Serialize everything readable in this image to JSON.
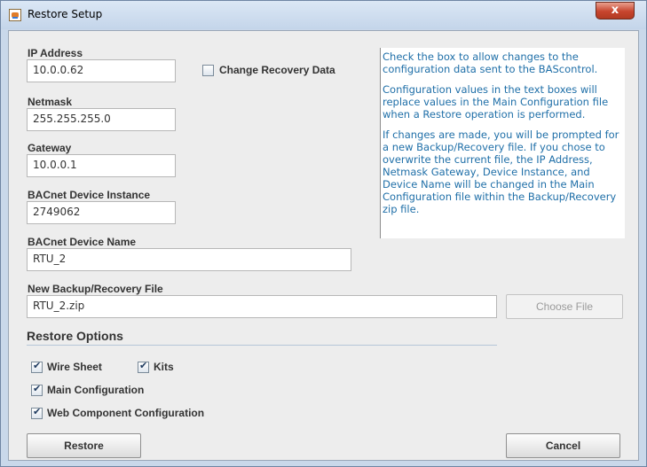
{
  "window": {
    "title": "Restore Setup",
    "close_symbol": "x"
  },
  "fields": {
    "ip_label": "IP Address",
    "ip_value": "10.0.0.62",
    "netmask_label": "Netmask",
    "netmask_value": "255.255.255.0",
    "gateway_label": "Gateway",
    "gateway_value": "10.0.0.1",
    "instance_label": "BACnet Device Instance",
    "instance_value": "2749062",
    "name_label": "BACnet Device Name",
    "name_value": "RTU_2",
    "file_label": "New Backup/Recovery File",
    "file_value": "RTU_2.zip"
  },
  "change_recovery": {
    "label": "Change Recovery Data",
    "checked": false
  },
  "help": {
    "p1": "Check the box to allow changes to the configuration data sent to the BAScontrol.",
    "p2": "Configuration values in the text boxes will replace values in the Main Configuration file when a Restore operation is performed.",
    "p3": "If changes are made, you will be prompted for a new Backup/Recovery file. If you chose to overwrite the current file, the IP Address, Netmask Gateway, Device Instance, and Device Name will be changed in the Main Configuration file within the Backup/Recovery zip file."
  },
  "buttons": {
    "choose_file": "Choose File",
    "restore": "Restore",
    "cancel": "Cancel"
  },
  "restore_options": {
    "title": "Restore Options",
    "wire_sheet": {
      "label": "Wire Sheet",
      "checked": true
    },
    "kits": {
      "label": "Kits",
      "checked": true
    },
    "main_config": {
      "label": "Main Configuration",
      "checked": true
    },
    "web_component": {
      "label": "Web Component Configuration",
      "checked": true
    }
  }
}
